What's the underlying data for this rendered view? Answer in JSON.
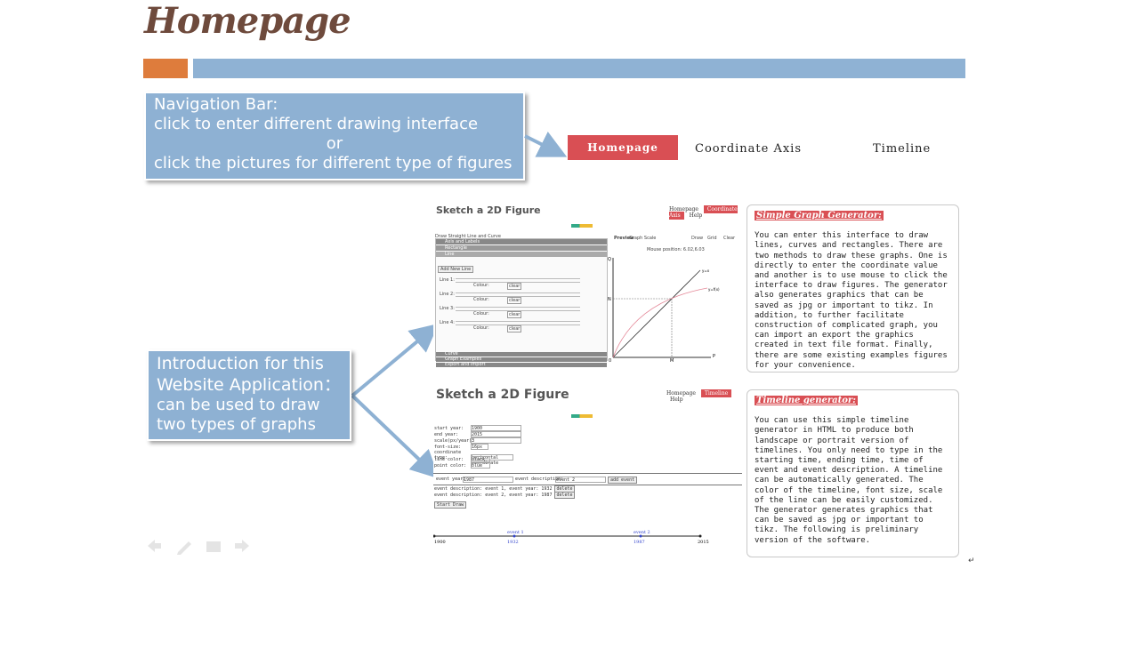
{
  "header": {
    "title": "Homepage"
  },
  "callout_nav": {
    "line1": "Navigation Bar:",
    "line2": "click  to enter different drawing interface",
    "line3": "or",
    "line4": "click the pictures for different  type of figures"
  },
  "nav": {
    "active": "Homepage",
    "items": [
      "Coordinate Axis",
      "Timeline"
    ]
  },
  "callout_intro": {
    "line1": "Introduction for this",
    "line2": "Website Application：",
    "line3": "can be used to draw",
    "line4": "two types of graphs"
  },
  "shot1": {
    "title": "Sketch a 2D Figure",
    "nav": [
      "Homepage",
      "Coordinate Axis",
      "Help"
    ],
    "panel_header": "Draw Straight Line and Curve",
    "sections": [
      "Axis and Labels",
      "Rectangle",
      "Line"
    ],
    "add_button": "Add New Line",
    "lines": [
      "Line 1:",
      "Line 2:",
      "Line 3:",
      "Line 4:"
    ],
    "colour_label": "Colour:",
    "clear_label": "clear",
    "bottom_sections": [
      "Curve",
      "Graph Examples",
      "Export and Import"
    ],
    "preview": "Preview",
    "graph_scale": "Graph Scale",
    "mouse_position": "Mouse position: 6.02,6.03",
    "buttons": [
      "Draw",
      "Grid",
      "Clear"
    ],
    "axis_labels": {
      "y": "Q",
      "x": "P",
      "n": "N",
      "m": "M",
      "o": "0",
      "yx": "y=x",
      "yfx": "y=f(x)"
    }
  },
  "desc1": {
    "title": "Simple Graph Generator:",
    "body": "You can enter this interface to draw lines, curves and rectangles. There are two methods to draw these graphs. One is directly to enter the coordinate value and another is to use mouse to click the interface to draw figures. The generator also generates graphics that can be saved as jpg or important to tikz. In addition, to further facilitate construction of complicated graph, you can import an export the graphics created in text file format. Finally, there are some existing examples figures for your convenience."
  },
  "shot2": {
    "title": "Sketch a 2D Figure",
    "nav": [
      "Homepage",
      "Timeline",
      "Help"
    ],
    "fields": [
      {
        "label": "start year:",
        "value": "1900"
      },
      {
        "label": "end year:",
        "value": "2015"
      },
      {
        "label": "scale(px/year):",
        "value": "3"
      },
      {
        "label": "font-size:",
        "value": "16px"
      },
      {
        "label": "coordinate type:",
        "value": "horizontal coordinate"
      },
      {
        "label": "line color:",
        "value": "black"
      },
      {
        "label": "point color:",
        "value": "blue"
      }
    ],
    "event_year_label": "event year:",
    "event_year_value": "1987",
    "event_desc_label": "event description:",
    "event_desc_value": "event 2",
    "add_event": "add event",
    "event_rows": [
      "event description: event 1, event year: 1932",
      "event description: event 2, event year: 1987"
    ],
    "delete_label": "delete",
    "start_draw": "Start Draw",
    "timeline": {
      "start": "1900",
      "end": "2015",
      "events": [
        {
          "name": "event 1",
          "year": "1932"
        },
        {
          "name": "event 2",
          "year": "1987"
        }
      ]
    }
  },
  "desc2": {
    "title": "Timeline generator:",
    "body": "You can use this simple timeline generator in HTML to produce both landscape or portrait version of timelines. You only need to type in the starting time, ending time, time of event and event description. A timeline can be automatically generated. The color of the timeline, font size, scale of the line can be easily customized. The generator generates graphics that can be saved as jpg or important to tikz. The following is preliminary version of the software."
  },
  "colors": {
    "accent_red": "#d94f54",
    "bar_blue": "#8fb2d4",
    "bar_orange": "#de7c3c",
    "title_brown": "#6e4a3c"
  },
  "controls": [
    "back-arrow-icon",
    "pen-icon",
    "menu-icon",
    "forward-arrow-icon"
  ],
  "paragraph_mark": "↵"
}
